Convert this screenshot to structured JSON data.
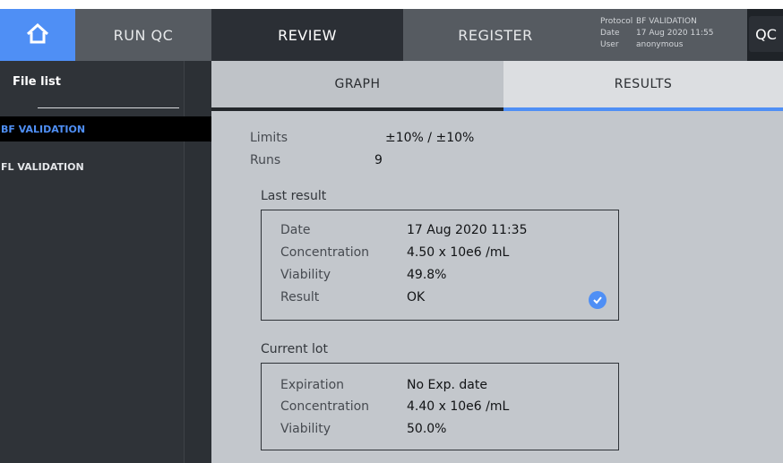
{
  "topbar": {
    "tabs": {
      "run_qc": "RUN QC",
      "review": "REVIEW",
      "register": "REGISTER"
    },
    "info": {
      "protocol_label": "Protocol",
      "protocol_value": "BF VALIDATION",
      "date_label": "Date",
      "date_value": "17 Aug 2020 11:55",
      "user_label": "User",
      "user_value": "anonymous"
    },
    "qc_button": "QC"
  },
  "sidebar": {
    "header": "File list",
    "items": [
      {
        "label": "BF VALIDATION",
        "selected": true
      },
      {
        "label": "FL VALIDATION",
        "selected": false
      }
    ]
  },
  "subtabs": {
    "graph": "GRAPH",
    "results": "RESULTS",
    "active": "RESULTS"
  },
  "results": {
    "limits_label": "Limits",
    "limits_value": "±10% / ±10%",
    "runs_label": "Runs",
    "runs_value": "9",
    "last_result": {
      "title": "Last result",
      "date_label": "Date",
      "date_value": "17 Aug 2020 11:35",
      "concentration_label": "Concentration",
      "concentration_value": "4.50 x 10e6 /mL",
      "viability_label": "Viability",
      "viability_value": "49.8%",
      "result_label": "Result",
      "result_value": "OK"
    },
    "current_lot": {
      "title": "Current lot",
      "expiration_label": "Expiration",
      "expiration_value": "No Exp. date",
      "concentration_label": "Concentration",
      "concentration_value": "4.40 x 10e6 /mL",
      "viability_label": "Viability",
      "viability_value": "50.0%"
    }
  },
  "colors": {
    "accent": "#4f8ff5",
    "dark": "#1f2328",
    "panel": "#c3c7cc"
  },
  "icons": {
    "home": "home-icon",
    "ok": "check-circle-icon"
  }
}
